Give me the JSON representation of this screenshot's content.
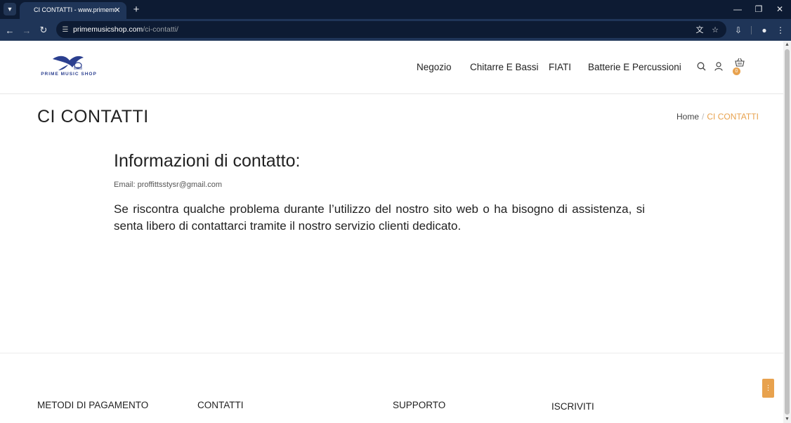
{
  "browser": {
    "tab_title": "CI CONTATTI - www.primemusicshop.com",
    "url_host": "primemusicshop.com",
    "url_path": "/ci-contatti/",
    "icons": {
      "tab_menu": "chevron-down-icon",
      "close_tab": "close-icon",
      "new_tab": "plus-icon",
      "back": "arrow-left-icon",
      "forward": "arrow-right-icon",
      "reload": "reload-icon",
      "site_info": "tune-icon",
      "translate": "translate-icon",
      "bookmark": "star-icon",
      "install": "install-icon",
      "profile": "person-icon",
      "menu": "kebab-menu-icon",
      "minimize": "minimize-icon",
      "restore": "restore-icon",
      "close_window": "close-icon"
    }
  },
  "site": {
    "logo_text": "PRIME MUSIC SHOP",
    "nav": [
      "Negozio",
      "Chitarre E Bassi",
      "FIATI",
      "Batterie E Percussioni"
    ],
    "cart_count": "0",
    "colors": {
      "accent": "#e8a24e",
      "brand": "#2b3f8f"
    }
  },
  "page": {
    "title": "CI CONTATTI",
    "breadcrumb": {
      "home": "Home",
      "separator": "/",
      "current": "CI CONTATTI"
    },
    "heading": "Informazioni di contatto:",
    "email_line": "Email: proffittsstysr@gmail.com",
    "paragraph": "Se riscontra qualche problema durante l’utilizzo del nostro sito web o ha bisogno di assistenza, si senta libero di contattarci tramite il nostro servizio clienti dedicato."
  },
  "footer": {
    "headings": [
      "METODI DI PAGAMENTO",
      "CONTATTI",
      "SUPPORTO",
      "ISCRIVITI"
    ]
  }
}
